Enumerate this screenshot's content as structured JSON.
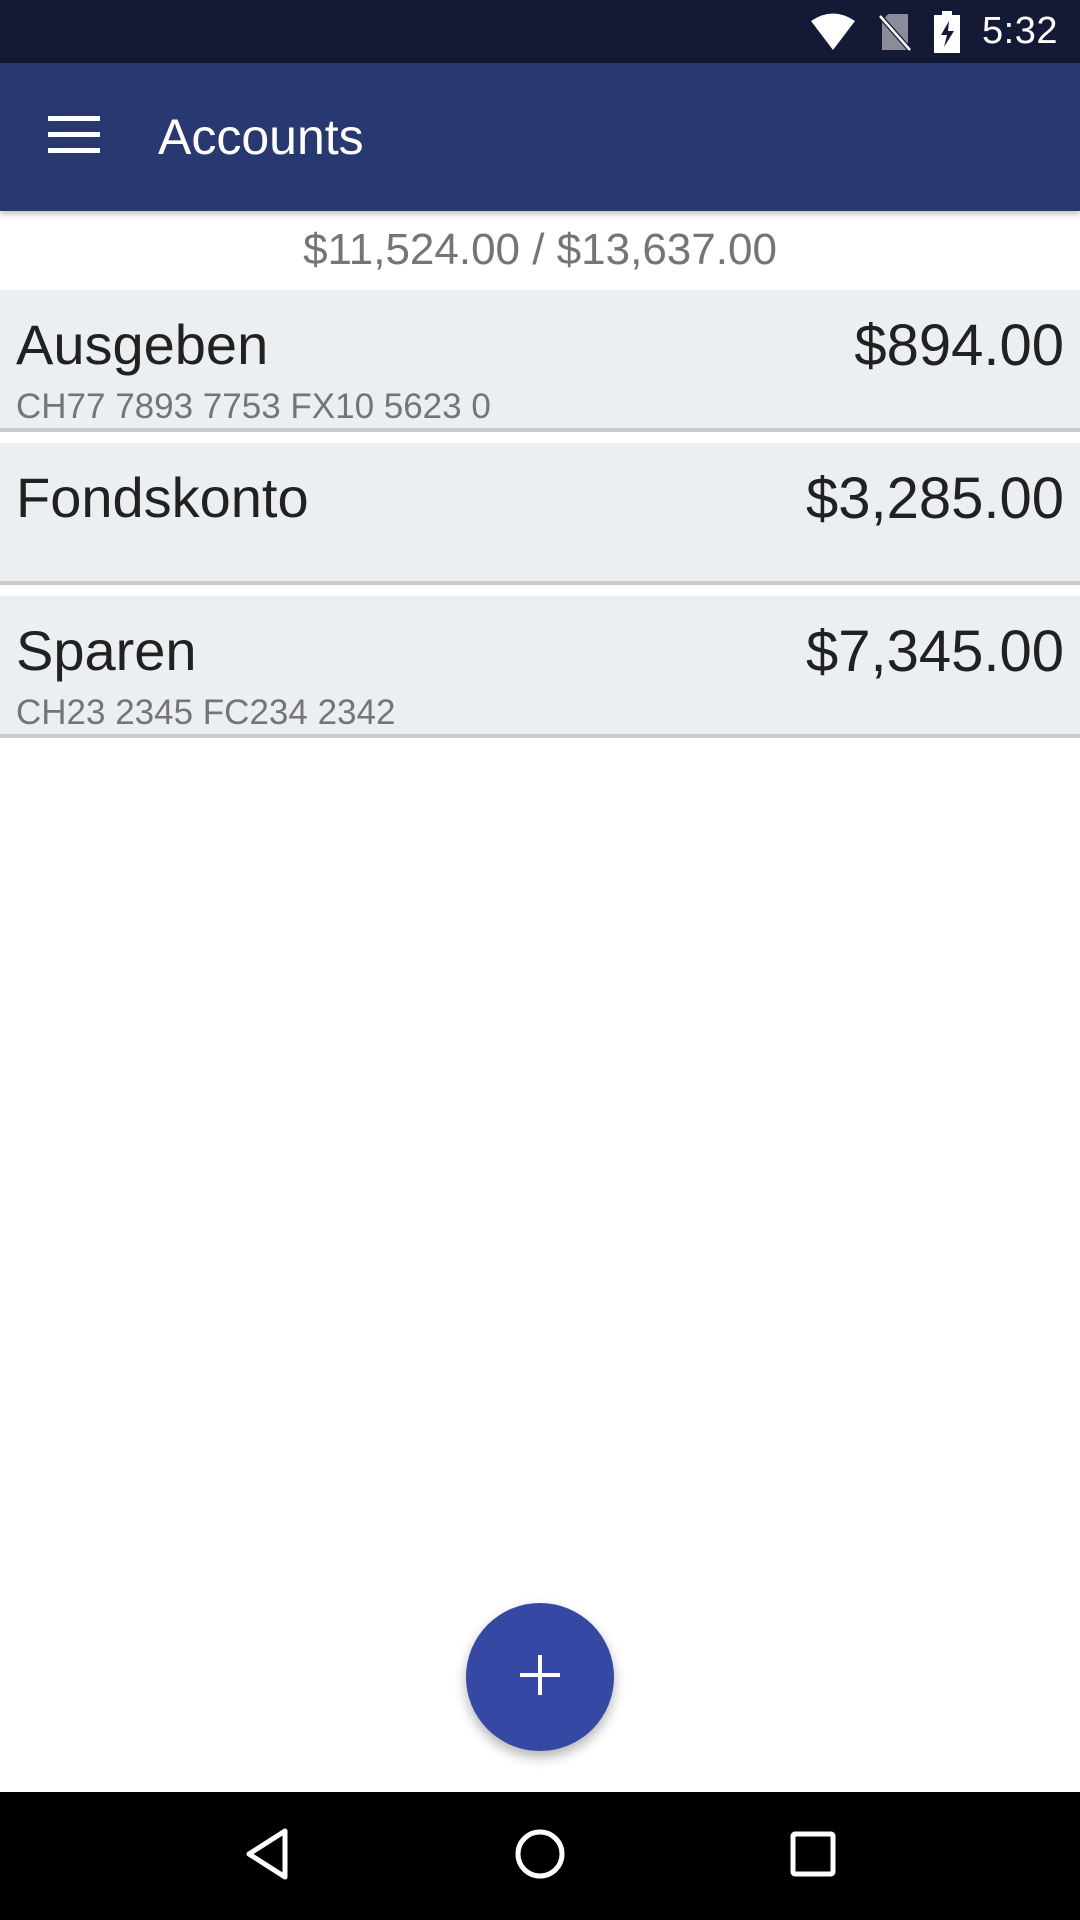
{
  "status_bar": {
    "time": "5:32",
    "icons": [
      "wifi-icon",
      "no-sim-icon",
      "battery-charging-icon"
    ]
  },
  "app_bar": {
    "title": "Accounts",
    "menu_icon": "menu-icon"
  },
  "summary": {
    "text": "$11,524.00 / $13,637.00"
  },
  "accounts": [
    {
      "name": "Ausgeben",
      "balance": "$894.00",
      "iban": "CH77 7893 7753 FX10 5623 0"
    },
    {
      "name": "Fondskonto",
      "balance": "$3,285.00",
      "iban": ""
    },
    {
      "name": "Sparen",
      "balance": "$7,345.00",
      "iban": "CH23 2345 FC234 2342"
    }
  ],
  "fab": {
    "icon": "add-icon"
  },
  "nav_bar": {
    "icons": [
      "back-icon",
      "home-icon",
      "recents-icon"
    ]
  },
  "colors": {
    "status_bar": "#141a35",
    "app_bar": "#283870",
    "row_background": "#eceff2",
    "fab": "#3548a3"
  }
}
